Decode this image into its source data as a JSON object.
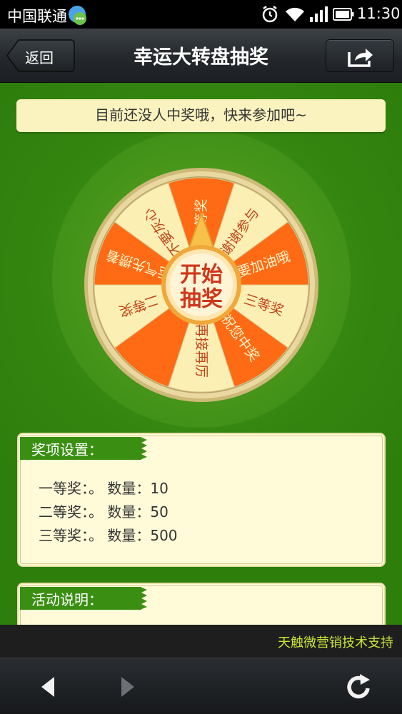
{
  "status_bar": {
    "carrier": "中国联通",
    "time": "11:30",
    "icons": [
      "qq-icon",
      "alarm-icon",
      "wifi-icon",
      "signal-icon",
      "battery-icon"
    ]
  },
  "header": {
    "back_label": "返回",
    "title": "幸运大转盘抽奖",
    "share_icon": "share-icon"
  },
  "banner": {
    "text": "目前还没人中奖哦，快来参加吧~"
  },
  "wheel": {
    "center_line1": "开始",
    "center_line2": "抽奖",
    "segments": [
      "一等奖",
      "谢谢参与",
      "要加油哦",
      "三等奖",
      "祝您中奖",
      "再接再厉",
      "",
      "二等奖",
      "运气先攒着",
      "不要灰心"
    ],
    "colors": {
      "orange": "#ff6a14",
      "cream": "#fbefb4",
      "rim": "#e9d9a0",
      "label_dark": "#c1451a",
      "label_light": "#fdf4c8"
    }
  },
  "prizes": {
    "title": "奖项设置：",
    "items": [
      {
        "name": "一等奖：",
        "desc": "。",
        "qty_label": "数量：",
        "qty": "10"
      },
      {
        "name": "二等奖：",
        "desc": "。",
        "qty_label": "数量：",
        "qty": "50"
      },
      {
        "name": "三等奖：",
        "desc": "。",
        "qty_label": "数量：",
        "qty": "500"
      }
    ]
  },
  "instructions": {
    "title": "活动说明："
  },
  "footer": {
    "support_text": "天触微营销技术支持"
  },
  "navbar": {
    "icons": [
      "back-arrow-icon",
      "forward-arrow-icon",
      "refresh-icon"
    ]
  }
}
